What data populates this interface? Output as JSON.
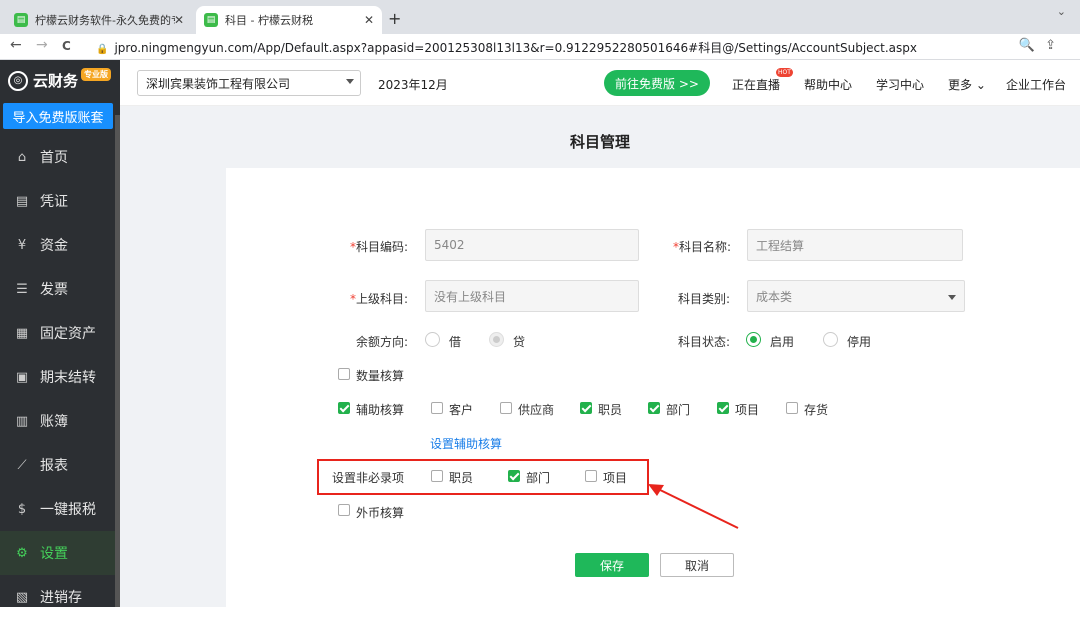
{
  "browser": {
    "tabs": [
      {
        "title": "柠檬云财务软件-永久免费的专业...",
        "close": "✕"
      },
      {
        "title": "科目 - 柠檬云财税",
        "close": "✕"
      }
    ],
    "new_tab": "+",
    "menu": "⌄",
    "url": "jpro.ningmengyun.com/App/Default.aspx?appasid=200125308l13l13&r=0.9122952280501646#科目@/Settings/AccountSubject.aspx",
    "back": "←",
    "forward": "→",
    "reload": "C",
    "zoom": "🔍",
    "share": "⇪"
  },
  "sidebar": {
    "logo_text": "云财务",
    "logo_badge": "专业版",
    "import_button": "导入免费版账套",
    "items": [
      {
        "label": "首页",
        "icon": "home-icon",
        "glyph": "⌂"
      },
      {
        "label": "凭证",
        "icon": "voucher-icon",
        "glyph": "▤"
      },
      {
        "label": "资金",
        "icon": "fund-icon",
        "glyph": "¥"
      },
      {
        "label": "发票",
        "icon": "invoice-icon",
        "glyph": "☰"
      },
      {
        "label": "固定资产",
        "icon": "asset-icon",
        "glyph": "▦"
      },
      {
        "label": "期末结转",
        "icon": "period-close-icon",
        "glyph": "▣"
      },
      {
        "label": "账簿",
        "icon": "ledger-icon",
        "glyph": "▥"
      },
      {
        "label": "报表",
        "icon": "report-icon",
        "glyph": "⟋"
      },
      {
        "label": "一键报税",
        "icon": "tax-icon",
        "glyph": "$"
      },
      {
        "label": "设置",
        "icon": "settings-icon",
        "glyph": "⚙",
        "active": true
      },
      {
        "label": "进销存",
        "icon": "inventory-icon",
        "glyph": "▧"
      }
    ]
  },
  "header": {
    "company": "深圳宾果装饰工程有限公司",
    "period": "2023年12月",
    "goto_free": "前往免费版 >>",
    "live": "正在直播",
    "hot_badge": "HOT",
    "help": "帮助中心",
    "learn": "学习中心",
    "more": "更多 ⌄",
    "workbench": "企业工作台"
  },
  "page": {
    "title": "科目管理",
    "required_mark": "*",
    "code_label": "科目编码:",
    "code_value": "5402",
    "name_label": "科目名称:",
    "name_value": "工程结算",
    "parent_label": "上级科目:",
    "parent_value": "没有上级科目",
    "category_label": "科目类别:",
    "category_value": "成本类",
    "balance_label": "余额方向:",
    "debit": "借",
    "credit": "贷",
    "status_label": "科目状态:",
    "enabled": "启用",
    "disabled": "停用",
    "quantity": "数量核算",
    "auxiliary": "辅助核算",
    "aux_options": [
      {
        "label": "客户",
        "checked": false
      },
      {
        "label": "供应商",
        "checked": false
      },
      {
        "label": "职员",
        "checked": true
      },
      {
        "label": "部门",
        "checked": true
      },
      {
        "label": "项目",
        "checked": true
      },
      {
        "label": "存货",
        "checked": false
      }
    ],
    "set_aux_link": "设置辅助核算",
    "nonrequired_label": "设置非必录项",
    "nonrequired_options": [
      {
        "label": "职员",
        "checked": false
      },
      {
        "label": "部门",
        "checked": true
      },
      {
        "label": "项目",
        "checked": false
      }
    ],
    "foreign_currency": "外币核算",
    "save": "保存",
    "cancel": "取消"
  },
  "colors": {
    "accent_green": "#1fb85a",
    "highlight_red": "#e8241c",
    "link_blue": "#1a7ee8",
    "sidebar_bg": "#2c2f33"
  }
}
